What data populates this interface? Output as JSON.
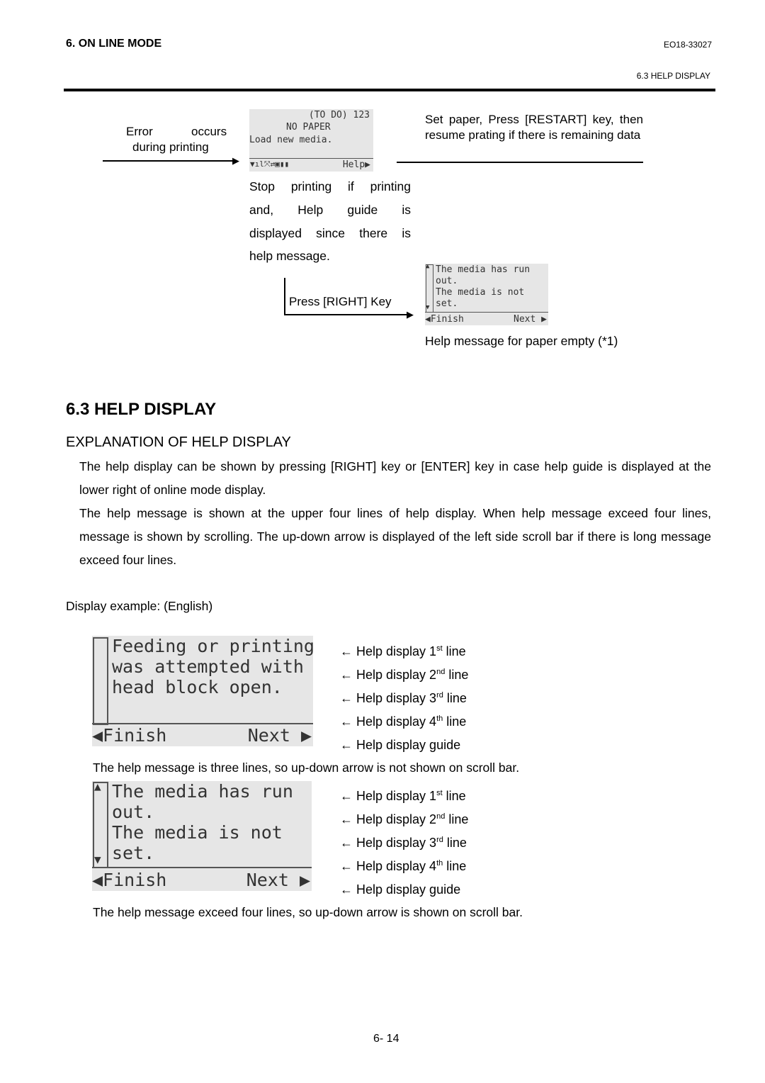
{
  "header": {
    "chapter": "6. ON LINE MODE",
    "doc_no": "EO18-33027",
    "section": "6.3 HELP DISPLAY"
  },
  "flow": {
    "error_line1_a": "Error",
    "error_line1_b": "occurs",
    "error_line2": "during printing",
    "lcd1": {
      "top": "(TO DO) 123",
      "status": "NO PAPER",
      "message": "Load new media.",
      "icons": "▼ıl⤧⇄▣▮▮",
      "help": "Help▶"
    },
    "restart_text": "Set paper, Press [RESTART] key, then resume prating if there is remaining data",
    "stop_text": [
      "Stop printing if printing",
      "and, Help guide is",
      "displayed since there is",
      "help message."
    ],
    "press_right": "Press [RIGHT] Key",
    "lcd2": {
      "lines": [
        "The media has run",
        "out.",
        "The media is not",
        "set."
      ],
      "finish": "◀Finish",
      "next": "Next ▶"
    },
    "lcd2_caption": "Help message for paper empty (*1)"
  },
  "section": {
    "title": "6.3  HELP DISPLAY",
    "subtitle": "EXPLANATION OF HELP DISPLAY",
    "paragraphs": [
      "The help display can be shown by pressing [RIGHT] key or [ENTER] key in case help guide is displayed at the lower right of online mode display.",
      "The help message is shown at the upper four lines of help display. When help message exceed four lines, message is shown by scrolling. The up-down arrow is displayed of the left side scroll bar if there is long message exceed four lines."
    ],
    "example_label": "Display example: (English)"
  },
  "example1": {
    "lines": [
      "Feeding or printing",
      "was attempted with",
      "head block open."
    ],
    "finish": "◀Finish",
    "next": "Next ▶",
    "caption": "The help message is three lines, so up-down arrow is not shown on scroll bar."
  },
  "example2": {
    "lines": [
      "The media has run",
      "out.",
      "The media is not",
      "set."
    ],
    "finish": "◀Finish",
    "next": "Next ▶",
    "caption": "The help message exceed four lines, so up-down arrow is shown on scroll bar."
  },
  "labels": [
    {
      "text": "← Help display 1",
      "sup": "st",
      "after": " line"
    },
    {
      "text": "← Help display 2",
      "sup": "nd",
      "after": " line"
    },
    {
      "text": "← Help display 3",
      "sup": "rd",
      "after": " line"
    },
    {
      "text": "← Help display 4",
      "sup": "th",
      "after": " line"
    },
    {
      "text": "← Help display guide",
      "sup": "",
      "after": ""
    }
  ],
  "footer": {
    "page": "6- 14"
  }
}
